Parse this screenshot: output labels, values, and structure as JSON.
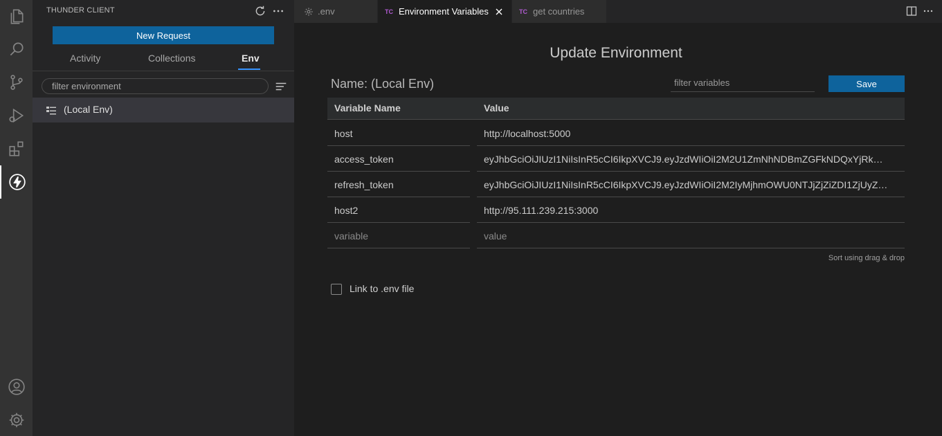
{
  "activity_bar": {
    "items": [
      {
        "icon": "files-icon"
      },
      {
        "icon": "search-icon"
      },
      {
        "icon": "source-control-icon"
      },
      {
        "icon": "run-debug-icon"
      },
      {
        "icon": "extensions-icon"
      },
      {
        "icon": "thunder-client-icon",
        "active": true
      },
      {
        "icon": "account-icon"
      },
      {
        "icon": "settings-gear-icon"
      }
    ]
  },
  "sidebar": {
    "title": "THUNDER CLIENT",
    "new_request_label": "New Request",
    "tabs": [
      {
        "label": "Activity"
      },
      {
        "label": "Collections"
      },
      {
        "label": "Env",
        "active": true
      }
    ],
    "filter_placeholder": "filter environment",
    "environments": [
      {
        "label": "(Local Env)",
        "selected": true
      }
    ]
  },
  "editor_tabs": [
    {
      "label": ".env",
      "icon": "gear-icon"
    },
    {
      "label": "Environment Variables",
      "badge": "TC",
      "active": true
    },
    {
      "label": "get countries",
      "badge": "TC"
    }
  ],
  "main": {
    "title": "Update Environment",
    "name_label": "Name: (Local Env)",
    "filter_placeholder": "filter variables",
    "save_label": "Save",
    "columns": {
      "name": "Variable Name",
      "value": "Value"
    },
    "variables": [
      {
        "name": "host",
        "value": "http://localhost:5000"
      },
      {
        "name": "access_token",
        "value": "eyJhbGciOiJIUzI1NiIsInR5cCI6IkpXVCJ9.eyJzdWIiOiI2M2U1ZmNhNDBmZGFkNDQxYjRkY…"
      },
      {
        "name": "refresh_token",
        "value": "eyJhbGciOiJIUzI1NiIsInR5cCI6IkpXVCJ9.eyJzdWIiOiI2M2IyMjhmOWU0NTJjZjZiZDI1ZjUyZT…"
      },
      {
        "name": "host2",
        "value": "http://95.111.239.215:3000"
      }
    ],
    "new_row": {
      "name_placeholder": "variable",
      "value_placeholder": "value"
    },
    "sort_hint": "Sort using drag & drop",
    "link_env_label": "Link to .env file",
    "link_env_checked": false
  },
  "colors": {
    "accent": "#0e639c",
    "tab_underline": "#3794ff",
    "tc_badge": "#b05bd1"
  }
}
